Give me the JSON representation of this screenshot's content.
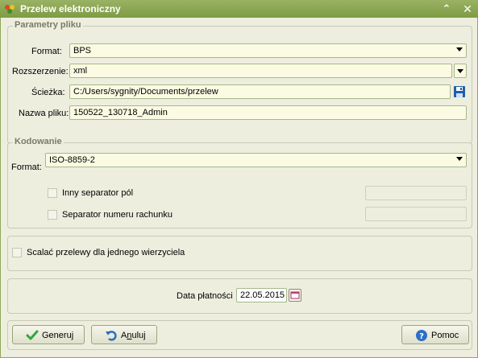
{
  "window": {
    "title": "Przelew elektroniczny"
  },
  "file_params": {
    "title": "Parametry pliku",
    "format_label": "Format:",
    "format_value": "BPS",
    "extension_label": "Rozszerzenie:",
    "extension_value": "xml",
    "path_label": "Ścieżka:",
    "path_value": "C:/Users/sygnity/Documents/przelew",
    "filename_label": "Nazwa pliku:",
    "filename_value": "150522_130718_Admin"
  },
  "encoding": {
    "title": "Kodowanie",
    "format_label": "Format:",
    "format_value": "ISO-8859-2",
    "other_separator_label": "Inny separator pól",
    "account_separator_label": "Separator numeru rachunku"
  },
  "merge": {
    "label": "Scalać przelewy dla jednego wierzyciela"
  },
  "payment": {
    "date_label": "Data płatności",
    "date_value": "22.05.2015"
  },
  "buttons": {
    "generate": "Generuj",
    "cancel_prefix": "A",
    "cancel_underlined": "n",
    "cancel_suffix": "uluj",
    "help": "Pomoc"
  },
  "colors": {
    "titlebar": "#8aa54f",
    "field_bg": "#fbfbe3",
    "window_bg": "#eeeedf",
    "save_icon": "#1f5fa8",
    "help_icon": "#2b6fc7",
    "check_icon": "#2fa83a"
  }
}
